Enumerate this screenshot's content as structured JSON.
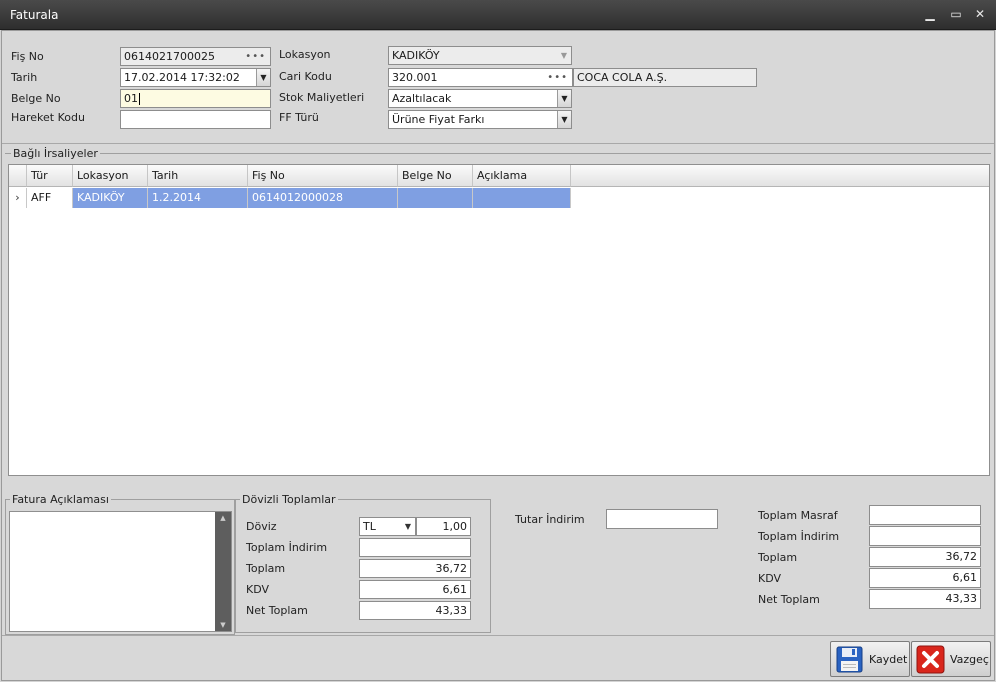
{
  "window": {
    "title": "Faturala",
    "minimize_glyph": "▁",
    "maximize_glyph": "▭",
    "close_glyph": "✕"
  },
  "header": {
    "fis_no": {
      "label": "Fiş No",
      "value": "0614021700025"
    },
    "tarih": {
      "label": "Tarih",
      "value": "17.02.2014 17:32:02"
    },
    "belge_no": {
      "label": "Belge No",
      "value": "01"
    },
    "hareket_kodu": {
      "label": "Hareket Kodu",
      "value": ""
    },
    "lokasyon": {
      "label": "Lokasyon",
      "value": "KADIKÖY"
    },
    "cari_kodu": {
      "label": "Cari Kodu",
      "value": "320.001",
      "name": "COCA COLA A.Ş."
    },
    "stok_maliyetleri": {
      "label": "Stok Maliyetleri",
      "value": "Azaltılacak"
    },
    "ff_turu": {
      "label": "FF Türü",
      "value": "Ürüne Fiyat Farkı"
    }
  },
  "bagli_irsaliyeler": {
    "title": "Bağlı İrsaliyeler",
    "columns": [
      "Tür",
      "Lokasyon",
      "Tarih",
      "Fiş No",
      "Belge No",
      "Açıklama"
    ],
    "rows": [
      {
        "indicator": "›",
        "tur": "AFF",
        "lokasyon": "KADIKÖY",
        "tarih": "1.2.2014",
        "fis_no": "0614012000028",
        "belge_no": "",
        "aciklama": ""
      }
    ]
  },
  "fatura_aciklamasi": {
    "title": "Fatura Açıklaması",
    "value": ""
  },
  "dovizli_toplamlar": {
    "title": "Dövizli Toplamlar",
    "doviz": {
      "label": "Döviz",
      "currency": "TL",
      "rate": "1,00"
    },
    "toplam_indirim": {
      "label": "Toplam İndirim",
      "value": ""
    },
    "toplam": {
      "label": "Toplam",
      "value": "36,72"
    },
    "kdv": {
      "label": "KDV",
      "value": "6,61"
    },
    "net_toplam": {
      "label": "Net Toplam",
      "value": "43,33"
    }
  },
  "tutar_indirim": {
    "label": "Tutar İndirim",
    "value": ""
  },
  "totals": {
    "toplam_masraf": {
      "label": "Toplam Masraf",
      "value": ""
    },
    "toplam_indirim": {
      "label": "Toplam İndirim",
      "value": ""
    },
    "toplam": {
      "label": "Toplam",
      "value": "36,72"
    },
    "kdv": {
      "label": "KDV",
      "value": "6,61"
    },
    "net_toplam": {
      "label": "Net Toplam",
      "value": "43,33"
    }
  },
  "buttons": {
    "save": "Kaydet",
    "cancel": "Vazgeç"
  },
  "colors": {
    "selected_row": "#7f9fe2",
    "titlebar": "#3a3a3a",
    "cancel_icon": "#d9261c",
    "save_icon": "#2a63c2"
  }
}
